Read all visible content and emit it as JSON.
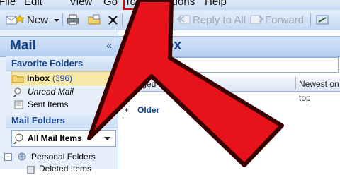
{
  "menu": {
    "file": "File",
    "edit": "Edit",
    "view": "View",
    "go": "Go",
    "tools": "Tools",
    "actions": "Actions",
    "help": "Help"
  },
  "toolbar": {
    "new_label": "New",
    "reply_label": "Reply",
    "reply_all_label": "Reply to All",
    "forward_label": "Forward"
  },
  "nav": {
    "title": "Mail",
    "favorites_header": "Favorite Folders",
    "favorites": [
      {
        "label": "Inbox",
        "count": "(396)"
      },
      {
        "label": "Unread Mail"
      },
      {
        "label": "Sent Items"
      }
    ],
    "mail_folders_header": "Mail Folders",
    "all_mail_items": "All Mail Items",
    "personal_folders": "Personal Folders",
    "deleted_items": "Deleted Items"
  },
  "main": {
    "title": "Inbox",
    "search_placeholder": "Search Inbox",
    "arranged_by": "Arranged By: Date",
    "sort_order": "Newest on top",
    "group_label": "Older"
  },
  "colors": {
    "highlight": "#d40000",
    "arrow_fill": "#e8121a",
    "accent": "#15428b"
  }
}
